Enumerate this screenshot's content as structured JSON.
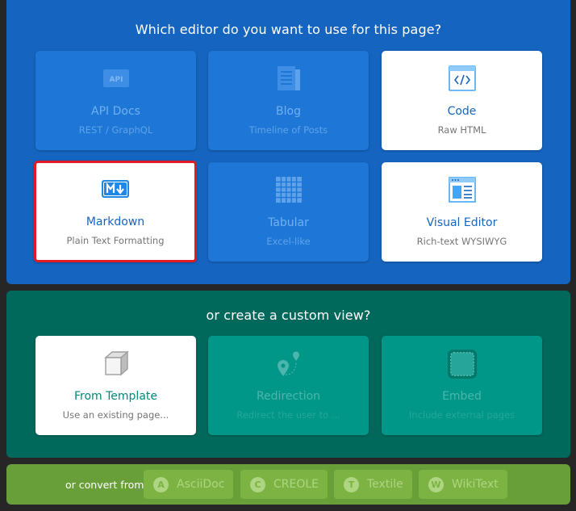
{
  "editor_section": {
    "title": "Which editor do you want to use for this page?",
    "cards": [
      {
        "title": "API Docs",
        "subtitle": "REST / GraphQL",
        "icon": "api-icon",
        "state": "disabled"
      },
      {
        "title": "Blog",
        "subtitle": "Timeline of Posts",
        "icon": "blog-icon",
        "state": "disabled"
      },
      {
        "title": "Code",
        "subtitle": "Raw HTML",
        "icon": "code-icon",
        "state": "enabled"
      },
      {
        "title": "Markdown",
        "subtitle": "Plain Text Formatting",
        "icon": "markdown-icon",
        "state": "selected"
      },
      {
        "title": "Tabular",
        "subtitle": "Excel-like",
        "icon": "table-icon",
        "state": "disabled"
      },
      {
        "title": "Visual Editor",
        "subtitle": "Rich-text WYSIWYG",
        "icon": "visual-editor-icon",
        "state": "enabled"
      }
    ]
  },
  "custom_section": {
    "title": "or create a custom view?",
    "cards": [
      {
        "title": "From Template",
        "subtitle": "Use an existing page...",
        "icon": "cube-icon",
        "state": "enabled"
      },
      {
        "title": "Redirection",
        "subtitle": "Redirect the user to ...",
        "icon": "map-pin-icon",
        "state": "disabled"
      },
      {
        "title": "Embed",
        "subtitle": "Include external pages",
        "icon": "embed-icon",
        "state": "disabled"
      }
    ]
  },
  "convert_section": {
    "label": "or convert from",
    "buttons": [
      {
        "label": "AsciiDoc",
        "badge": "A"
      },
      {
        "label": "CREOLE",
        "badge": "C"
      },
      {
        "label": "Textile",
        "badge": "T"
      },
      {
        "label": "WikiText",
        "badge": "W"
      }
    ]
  },
  "colors": {
    "editor_panel": "#1565c0",
    "custom_panel": "#00695c",
    "convert_panel": "#689f38",
    "selection_border": "#e01b24"
  }
}
